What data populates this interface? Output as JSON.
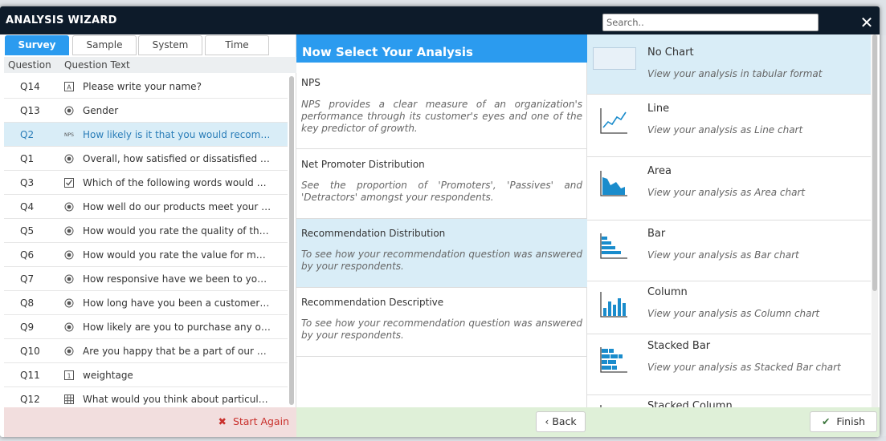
{
  "window": {
    "title": "ANALYSIS WIZARD",
    "search_placeholder": "Search..",
    "close_label": "✕"
  },
  "tabs": [
    {
      "label": "Survey",
      "active": true
    },
    {
      "label": "Sample",
      "active": false
    },
    {
      "label": "System",
      "active": false
    },
    {
      "label": "Time",
      "active": false
    }
  ],
  "question_table": {
    "headers": [
      "Question",
      "Question Text"
    ],
    "rows": [
      {
        "id": "Q14",
        "icon": "text-icon",
        "text": "Please write your name?",
        "selected": false
      },
      {
        "id": "Q13",
        "icon": "radio-icon",
        "text": "Gender",
        "selected": false
      },
      {
        "id": "Q2",
        "icon": "nps-icon",
        "icon_text": "NPS",
        "text": "How likely is it that you would recomm...",
        "selected": true
      },
      {
        "id": "Q1",
        "icon": "radio-icon",
        "text": "Overall, how satisfied or dissatisfied ar...",
        "selected": false
      },
      {
        "id": "Q3",
        "icon": "checkbox-icon",
        "text": "Which of the following words would yo...",
        "selected": false
      },
      {
        "id": "Q4",
        "icon": "radio-icon",
        "text": "How well do our products meet your ne...",
        "selected": false
      },
      {
        "id": "Q5",
        "icon": "radio-icon",
        "text": "How would you rate the quality of the ...",
        "selected": false
      },
      {
        "id": "Q6",
        "icon": "radio-icon",
        "text": "How would you rate the value for mone...",
        "selected": false
      },
      {
        "id": "Q7",
        "icon": "radio-icon",
        "text": "How responsive have we been to your ...",
        "selected": false
      },
      {
        "id": "Q8",
        "icon": "radio-icon",
        "text": "How long have you been a customer of...",
        "selected": false
      },
      {
        "id": "Q9",
        "icon": "radio-icon",
        "text": "How likely are you to purchase any of o...",
        "selected": false
      },
      {
        "id": "Q10",
        "icon": "radio-icon",
        "text": "Are you happy that be a part of our co...",
        "selected": false
      },
      {
        "id": "Q11",
        "icon": "number-icon",
        "text": "weightage",
        "selected": false
      },
      {
        "id": "Q12",
        "icon": "grid-icon",
        "text": "What would you think about particular...",
        "selected": false
      }
    ]
  },
  "left_footer": {
    "start_again_label": "Start Again"
  },
  "analysis": {
    "heading": "Now Select Your Analysis",
    "items": [
      {
        "name": "NPS",
        "description": "NPS provides a clear measure of an organization's performance through its customer's eyes and one of the key predictor of growth.",
        "selected": false
      },
      {
        "name": "Net Promoter Distribution",
        "description": "See the proportion of 'Promoters', 'Passives' and 'Detractors' amongst your respondents.",
        "selected": false
      },
      {
        "name": "Recommendation Distribution",
        "description": "To see how your recommendation question was answered by your respondents.",
        "selected": true
      },
      {
        "name": "Recommendation Descriptive",
        "description": "To see how your recommendation question was answered by your respondents.",
        "selected": false
      }
    ],
    "back_label": "Back"
  },
  "charts": {
    "items": [
      {
        "name": "No Chart",
        "description": "View your analysis in tabular format",
        "icon": "table-icon",
        "selected": true
      },
      {
        "name": "Line",
        "description": "View your analysis as Line chart",
        "icon": "line-chart-icon",
        "selected": false
      },
      {
        "name": "Area",
        "description": "View your analysis as Area chart",
        "icon": "area-chart-icon",
        "selected": false
      },
      {
        "name": "Bar",
        "description": "View your analysis as Bar chart",
        "icon": "bar-chart-icon",
        "selected": false
      },
      {
        "name": "Column",
        "description": "View your analysis as Column chart",
        "icon": "column-chart-icon",
        "selected": false
      },
      {
        "name": "Stacked Bar",
        "description": "View your analysis as Stacked Bar chart",
        "icon": "stacked-bar-chart-icon",
        "selected": false
      },
      {
        "name": "Stacked Column",
        "description": "",
        "icon": "stacked-column-chart-icon",
        "selected": false
      }
    ],
    "finish_label": "Finish"
  },
  "colors": {
    "accent": "#2b9bef",
    "titlebar": "#0d1b2a",
    "selected_row": "#d9edf7",
    "footer_green": "#dff0d8",
    "footer_red": "#f2dede",
    "icon_blue": "#1a8ccc"
  }
}
